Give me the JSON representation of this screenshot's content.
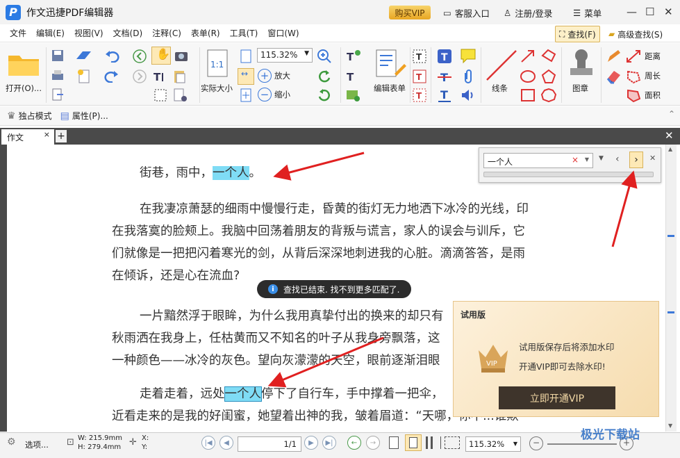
{
  "window": {
    "title": "作文迅捷PDF编辑器",
    "vip_button": "购买VIP",
    "service": "客服入口",
    "login": "注册/登录",
    "menu": "菜单"
  },
  "menubar": {
    "items": [
      "文件",
      "编辑(E)",
      "视图(V)",
      "文档(D)",
      "注释(C)",
      "表单(R)",
      "工具(T)",
      "窗口(W)"
    ],
    "find": "查找(F)",
    "advanced_find": "高级查找(S)"
  },
  "ribbon": {
    "open_label": "打开(O)...",
    "zoom_value": "115.32%",
    "actual_size": "实际大小",
    "zoom_in": "放大",
    "zoom_out": "缩小",
    "edit_form": "编辑表单",
    "line": "线条",
    "stamp": "图章",
    "distance": "距离",
    "perimeter": "周长",
    "area": "面积"
  },
  "modebar": {
    "exclusive": "独占模式",
    "properties": "属性(P)..."
  },
  "tabs": {
    "doc_tab": "作文"
  },
  "document": {
    "line1_prefix": "街巷，雨中，",
    "line1_hl": "一个人",
    "line1_suffix": "。",
    "p2_l1": "在我凄凉萧瑟的细雨中慢慢行走，昏黄的街灯无力地洒下冰冷的光线，印",
    "p2_l2": "在我落寞的脸颊上。我脑中回荡着朋友的背叛与谎言，家人的误会与训斥，它",
    "p2_l3": "们就像是一把把闪着寒光的剑，从背后深深地刺进我的心脏。滴滴答答，是雨",
    "p2_l4": "在倾诉，还是心在流血?",
    "p3_l1": "一片黯然浮于眼眸，为什么我用真挚付出的换来的却只有",
    "p3_l2": "秋雨洒在我身上，任枯黄而又不知名的叶子从我身旁飘落，这",
    "p3_l3": "一种颜色——冰冷的灰色。望向灰濛濛的天空，眼前逐渐泪眼",
    "p4_prefix": "走着走着，远处",
    "p4_hl": "一个人",
    "p4_suffix": "停下了自行车，手中撑着一把伞，",
    "p4_l2": "近看走来的是我的好闺蜜，她望着出神的我，皱着眉道：“天哪，你不...谁欺"
  },
  "toast": {
    "text": "查找已结束. 找不到更多匹配了."
  },
  "find_panel": {
    "query": "一个人"
  },
  "trial": {
    "title": "试用版",
    "line1": "试用版保存后将添加水印",
    "line2": "开通VIP即可去除水印!",
    "button": "立即开通VIP",
    "badge": "VIP"
  },
  "statusbar": {
    "options": "选项...",
    "width": "W: 215.9mm",
    "height": "H: 279.4mm",
    "x": "X:",
    "y": "Y:",
    "page": "1/1",
    "zoom": "115.32%"
  },
  "watermark": {
    "text": "极光下载站"
  },
  "colors": {
    "highlight": "#7fdcf5",
    "arrow": "#e02020",
    "vip": "#e8a623"
  }
}
